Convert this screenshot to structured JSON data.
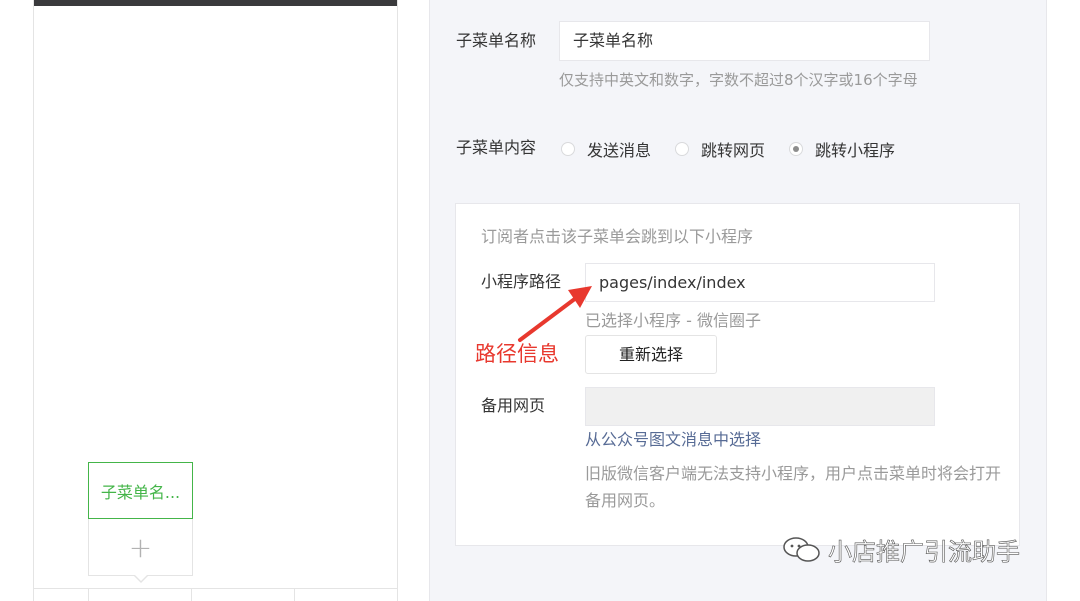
{
  "preview": {
    "submenu_item_label": "子菜单名...",
    "add_submenu_symbol": "+"
  },
  "form": {
    "name_label": "子菜单名称",
    "name_value": "子菜单名称",
    "name_hint": "仅支持中英文和数字，字数不超过8个汉字或16个字母",
    "content_label": "子菜单内容",
    "content_options": [
      {
        "label": "发送消息",
        "checked": false
      },
      {
        "label": "跳转网页",
        "checked": false
      },
      {
        "label": "跳转小程序",
        "checked": true
      }
    ],
    "miniprogram": {
      "intro": "订阅者点击该子菜单会跳到以下小程序",
      "path_label": "小程序路径",
      "path_value": "pages/index/index",
      "selected_text": "已选择小程序 - 微信圈子",
      "reselect_button": "重新选择",
      "backup_label": "备用网页",
      "backup_value": "",
      "backup_link": "从公众号图文消息中选择",
      "backup_hint": "旧版微信客户端无法支持小程序，用户点击菜单时将会打开备用网页。"
    }
  },
  "annotation": {
    "text": "路径信息",
    "color": "#e8382e"
  },
  "watermark": {
    "text": "小店推广引流助手",
    "icon": "wechat-chat-icon"
  },
  "colors": {
    "accent_green": "#44b549",
    "link_blue": "#576b95",
    "panel_bg": "#f4f5f9"
  }
}
